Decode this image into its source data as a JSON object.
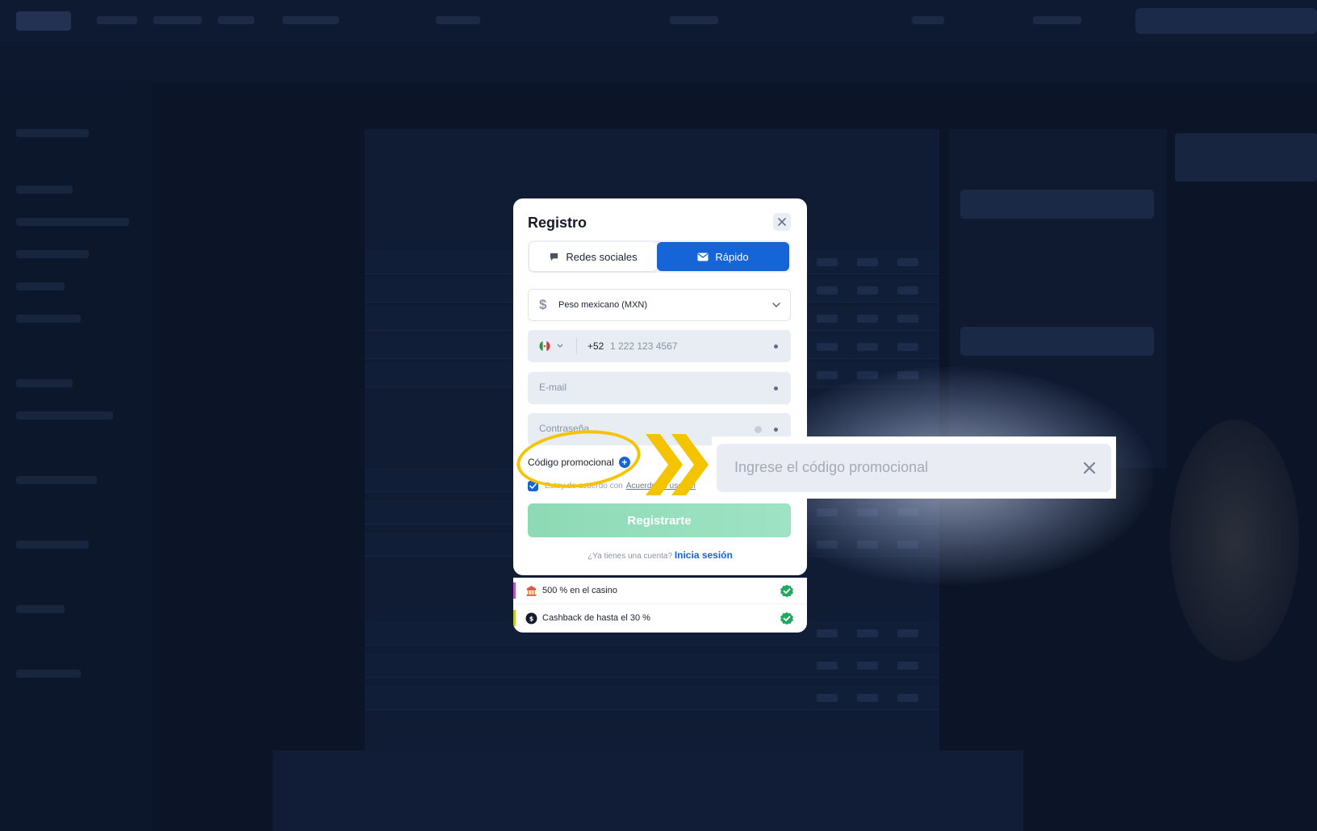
{
  "modal": {
    "title": "Registro",
    "tabs": [
      {
        "label": "Redes sociales",
        "icon": "chat-bubble-icon",
        "active": false
      },
      {
        "label": "Rápido",
        "icon": "envelope-icon",
        "active": true
      }
    ],
    "currency": {
      "symbol": "$",
      "value": "Peso mexicano (MXN)"
    },
    "phone": {
      "country_flag": "mexico-flag-icon",
      "code": "+52",
      "placeholder": "1 222 123 4567"
    },
    "email": {
      "placeholder": "E-mail"
    },
    "password": {
      "placeholder": "Contraseña"
    },
    "promo": {
      "label": "Código promocional",
      "add": "+"
    },
    "agree": {
      "text": "Estoy de acuerdo con",
      "link": "Acuerdo de uso del"
    },
    "submit_label": "Registrarte",
    "login": {
      "prompt": "¿Ya tienes una cuenta?",
      "link": "Inicia sesión"
    }
  },
  "bonuses": [
    {
      "text": "500 % en el casino",
      "icon": "casino-icon",
      "accent": "#c74bd6",
      "checked": true
    },
    {
      "text": "Cashback de hasta el 30 %",
      "icon": "cashback-icon",
      "accent": "#b7d31f",
      "checked": true
    }
  ],
  "promo_callout": {
    "placeholder": "Ingrese el código promocional"
  },
  "colors": {
    "accent_blue": "#1565d8",
    "submit_green": "#8edab5",
    "annotation_yellow": "#f5c400",
    "check_green": "#22a861",
    "overlay_bg": "#0c1527"
  }
}
